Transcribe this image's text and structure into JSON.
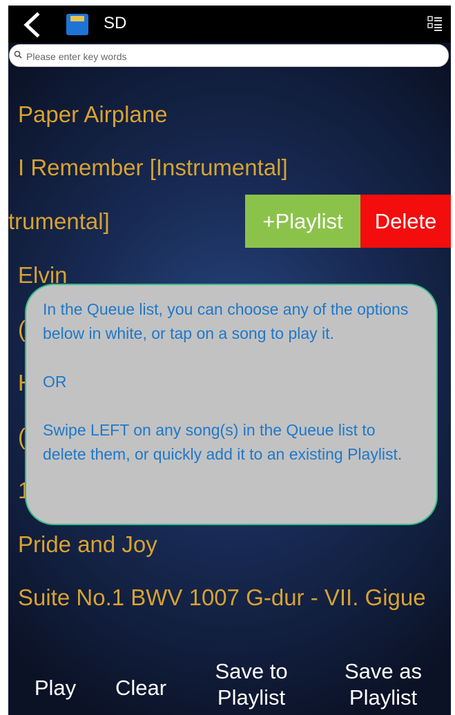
{
  "topbar": {
    "back_icon": "back-arrow-icon",
    "storage_icon": "sd-card-icon",
    "storage_label": "SD",
    "menu_icon": "list-menu-icon"
  },
  "search": {
    "placeholder": "Please enter key words",
    "value": ""
  },
  "songs": [
    "Paper Airplane",
    "I Remember [Instrumental]",
    "trumental]",
    "Elvin",
    "(",
    "H",
    "(",
    "1",
    "Pride and Joy",
    "Suite No.1 BWV 1007 G-dur - VII. Gigue"
  ],
  "swipe_actions": {
    "add_playlist": "+Playlist",
    "delete": "Delete"
  },
  "tooltip": {
    "line1": "In the Queue list, you can choose any of the options below in white, or tap on a song to play it.",
    "line2": "OR",
    "line3": "Swipe LEFT on any song(s) in the Queue list to delete them, or quickly add it to an existing Playlist."
  },
  "bottom": {
    "play": "Play",
    "clear": "Clear",
    "save_to_line1": "Save to",
    "save_to_line2": "Playlist",
    "save_as_line1": "Save as",
    "save_as_line2": "Playlist"
  },
  "colors": {
    "song_text": "#d8a231",
    "playlist_btn": "#8bc34a",
    "delete_btn": "#f40d0d",
    "tooltip_text": "#1f78c9",
    "tooltip_border": "#2fbc84"
  }
}
